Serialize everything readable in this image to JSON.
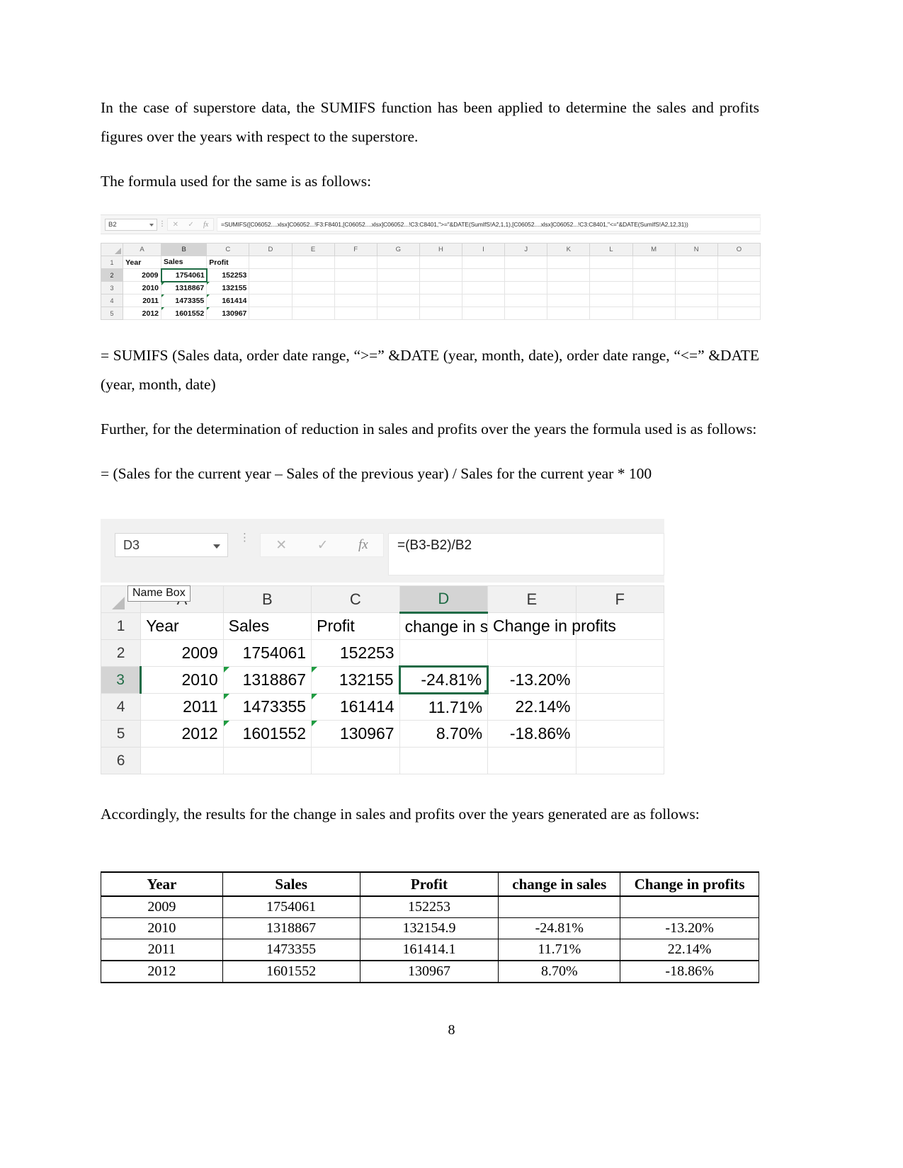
{
  "document": {
    "paragraphs": [
      "In the case of superstore data, the SUMIFS function has been applied to determine the sales and profits figures over the years with respect to the superstore.",
      "The formula used for the same is as follows:"
    ],
    "formula_sumifs": "= SUMIFS (Sales data, order date range, “>=” &DATE (year, month, date), order date range, “<=” &DATE (year, month, date)",
    "paragraph_reduction": "Further, for the determination of reduction in sales and profits over the years the formula used is as follows:",
    "formula_change": "= (Sales for the current year – Sales of the previous year) / Sales for the current year * 100",
    "paragraph_results": "Accordingly, the results for the change in sales and profits over the years generated are as follows:",
    "page_number": "8"
  },
  "excel_small": {
    "name_box": "B2",
    "formula": "=SUMIFS([C06052....xlsx]C06052...!F3:F8401,[C06052....xlsx]C06052...!C3:C8401,\">=\"&DATE(SumIfS!A2,1,1),[C06052....xlsx]C06052...!C3:C8401,\"<=\"&DATE(SumIfS!A2,12,31))",
    "icons": {
      "cancel": "✕",
      "accept": "✓",
      "fx": "fx"
    },
    "column_headers": [
      "A",
      "B",
      "C",
      "D",
      "E",
      "F",
      "G",
      "H",
      "I",
      "J",
      "K",
      "L",
      "M",
      "N",
      "O"
    ],
    "selected_column": "B",
    "row_headers": [
      "1",
      "2",
      "3",
      "4",
      "5"
    ],
    "selected_row": "2",
    "rows": [
      {
        "r": "1",
        "a": "Year",
        "b": "Sales",
        "c": "Profit"
      },
      {
        "r": "2",
        "a": "2009",
        "b": "1754061",
        "c": "152253"
      },
      {
        "r": "3",
        "a": "2010",
        "b": "1318867",
        "c": "132155"
      },
      {
        "r": "4",
        "a": "2011",
        "b": "1473355",
        "c": "161414"
      },
      {
        "r": "5",
        "a": "2012",
        "b": "1601552",
        "c": "130967"
      }
    ]
  },
  "excel_large": {
    "name_box": "D3",
    "name_box_tooltip": "Name Box",
    "formula": "=(B3-B2)/B2",
    "icons": {
      "cancel": "✕",
      "accept": "✓",
      "fx": "fx"
    },
    "column_headers": [
      "A",
      "B",
      "C",
      "D",
      "E",
      "F"
    ],
    "selected_column": "D",
    "selected_row": "3",
    "rows": [
      {
        "r": "1",
        "a": "Year",
        "b": "Sales",
        "c": "Profit",
        "d": "change in s",
        "e": "Change in profits",
        "f": ""
      },
      {
        "r": "2",
        "a": "2009",
        "b": "1754061",
        "c": "152253",
        "d": "",
        "e": "",
        "f": ""
      },
      {
        "r": "3",
        "a": "2010",
        "b": "1318867",
        "c": "132155",
        "d": "-24.81%",
        "e": "-13.20%",
        "f": ""
      },
      {
        "r": "4",
        "a": "2011",
        "b": "1473355",
        "c": "161414",
        "d": "11.71%",
        "e": "22.14%",
        "f": ""
      },
      {
        "r": "5",
        "a": "2012",
        "b": "1601552",
        "c": "130967",
        "d": "8.70%",
        "e": "-18.86%",
        "f": ""
      },
      {
        "r": "6",
        "a": "",
        "b": "",
        "c": "",
        "d": "",
        "e": "",
        "f": ""
      }
    ]
  },
  "results_table": {
    "headers": [
      "Year",
      "Sales",
      "Profit",
      "change in sales",
      "Change in profits"
    ],
    "rows": [
      [
        "2009",
        "1754061",
        "152253",
        "",
        ""
      ],
      [
        "2010",
        "1318867",
        "132154.9",
        "-24.81%",
        "-13.20%"
      ],
      [
        "2011",
        "1473355",
        "161414.1",
        "11.71%",
        "22.14%"
      ],
      [
        "2012",
        "1601552",
        "130967",
        "8.70%",
        "-18.86%"
      ]
    ]
  }
}
